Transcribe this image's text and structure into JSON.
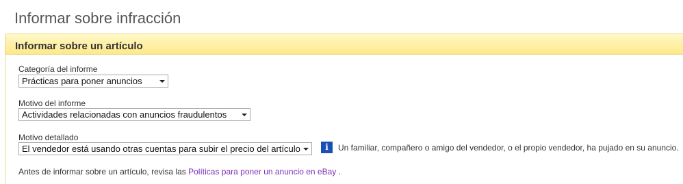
{
  "page": {
    "title": "Informar sobre infracción"
  },
  "panel": {
    "title": "Informar sobre un artículo"
  },
  "form": {
    "category": {
      "label": "Categoría del informe",
      "selected": "Prácticas para poner anuncios"
    },
    "reason": {
      "label": "Motivo del informe",
      "selected": "Actividades relacionadas con anuncios fraudulentos"
    },
    "detailed_reason": {
      "label": "Motivo detallado",
      "selected": "El vendedor está usando otras cuentas para subir el precio del artículo"
    }
  },
  "info": {
    "icon": "info-icon",
    "icon_glyph": "i",
    "text": "Un familiar, compañero o amigo del vendedor, o el propio vendedor, ha pujado en su anuncio."
  },
  "footer": {
    "prefix": "Antes de informar sobre un artículo, revisa las ",
    "link_text": "Políticas para poner un anuncio en eBay",
    "suffix": " ."
  },
  "colors": {
    "header_gradient_top": "#fff8c8",
    "header_gradient_bottom": "#fde98a",
    "link": "#7b2fb5",
    "info_icon": "#1a4fb3"
  }
}
